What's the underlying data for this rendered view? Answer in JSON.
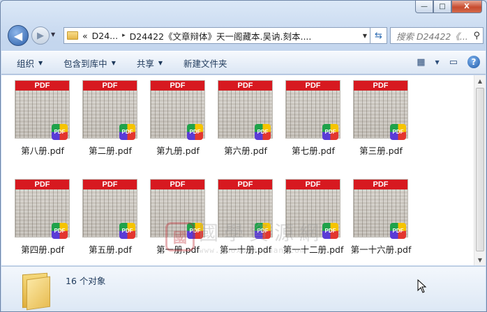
{
  "window": {
    "caption_buttons": {
      "minimize": "—",
      "maximize": "□",
      "close": "X"
    }
  },
  "navigation": {
    "back_icon": "◀",
    "forward_icon": "▶",
    "address": {
      "chevrons": "«",
      "segment_1": "D24...",
      "separator": "▸",
      "segment_2": "D24422《文章辩体》天一阁藏本.吴讷.刻本...."
    },
    "search_placeholder": "搜索 D24422《...",
    "search_icon": "search-icon"
  },
  "toolbar": {
    "organize": "组织",
    "include_in_library": "包含到库中",
    "share": "共享",
    "new_folder": "新建文件夹"
  },
  "files": [
    {
      "name": "第八册.pdf",
      "badge": "PDF",
      "header": "PDF"
    },
    {
      "name": "第二册.pdf",
      "badge": "PDF",
      "header": "PDF"
    },
    {
      "name": "第九册.pdf",
      "badge": "PDF",
      "header": "PDF"
    },
    {
      "name": "第六册.pdf",
      "badge": "PDF",
      "header": "PDF"
    },
    {
      "name": "第七册.pdf",
      "badge": "PDF",
      "header": "PDF"
    },
    {
      "name": "第三册.pdf",
      "badge": "PDF",
      "header": "PDF"
    },
    {
      "name": "第四册.pdf",
      "badge": "PDF",
      "header": "PDF"
    },
    {
      "name": "第五册.pdf",
      "badge": "PDF",
      "header": "PDF"
    },
    {
      "name": "第一册.pdf",
      "badge": "PDF",
      "header": "PDF"
    },
    {
      "name": "第一十册.pdf",
      "badge": "PDF",
      "header": "PDF"
    },
    {
      "name": "第一十二册.pdf",
      "badge": "PDF",
      "header": "PDF"
    },
    {
      "name": "第一十六册.pdf",
      "badge": "PDF",
      "header": "PDF"
    }
  ],
  "watermark": {
    "seal": "國",
    "title": "國學資源網",
    "url": "www.guoxueziyuan.com"
  },
  "status": {
    "item_count": "16 个对象"
  }
}
